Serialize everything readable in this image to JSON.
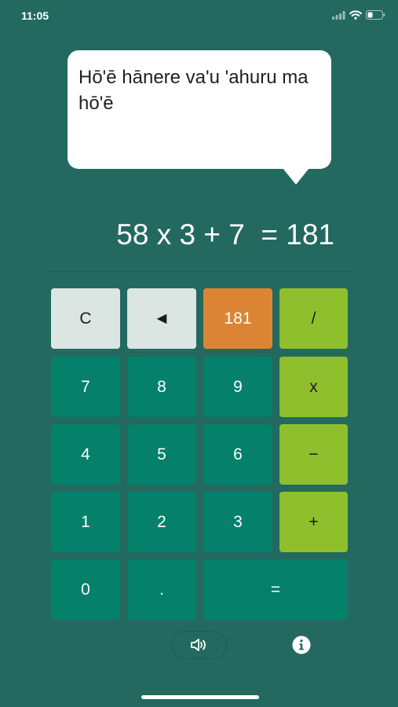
{
  "status_bar": {
    "time": "11:05"
  },
  "speech_bubble": {
    "text": "Hō'ē hānere va'u 'ahuru ma hō'ē"
  },
  "display": {
    "expression": "58 x 3 + 7  = 181"
  },
  "keypad": {
    "clear": "C",
    "backspace": "◄",
    "result": "181",
    "divide": "/",
    "seven": "7",
    "eight": "8",
    "nine": "9",
    "multiply": "x",
    "four": "4",
    "five": "5",
    "six": "6",
    "subtract": "−",
    "one": "1",
    "two": "2",
    "three": "3",
    "add": "+",
    "zero": "0",
    "decimal": ".",
    "equals": "="
  },
  "footer": {
    "sound_icon": "speaker-icon",
    "info_icon": "info-icon"
  },
  "colors": {
    "background": "#23695f",
    "number_key": "#04806b",
    "operator_key": "#8fbf2d",
    "light_key": "#dbe5e1",
    "result_key": "#db8534"
  }
}
